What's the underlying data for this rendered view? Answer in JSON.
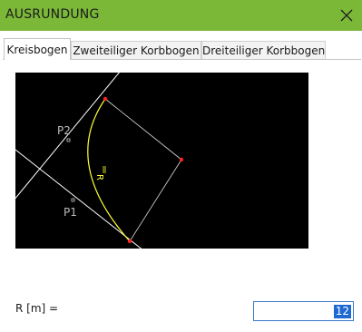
{
  "window": {
    "title": "AUSRUNDUNG",
    "close_icon": "close-icon"
  },
  "tabs": [
    {
      "label": "Kreisbogen",
      "active": true
    },
    {
      "label": "Zweiteiliger Korbbogen",
      "active": false
    },
    {
      "label": "Dreiteiliger Korbbogen",
      "active": false
    }
  ],
  "preview": {
    "labels": {
      "p2": "P2",
      "p1": "P1",
      "radius_mark": "R"
    },
    "colors": {
      "background": "#000000",
      "lines": "#ffffff",
      "arc": "#ffff33",
      "points": "#ff2020"
    }
  },
  "radius": {
    "label": "R [m] =",
    "value": "12"
  }
}
